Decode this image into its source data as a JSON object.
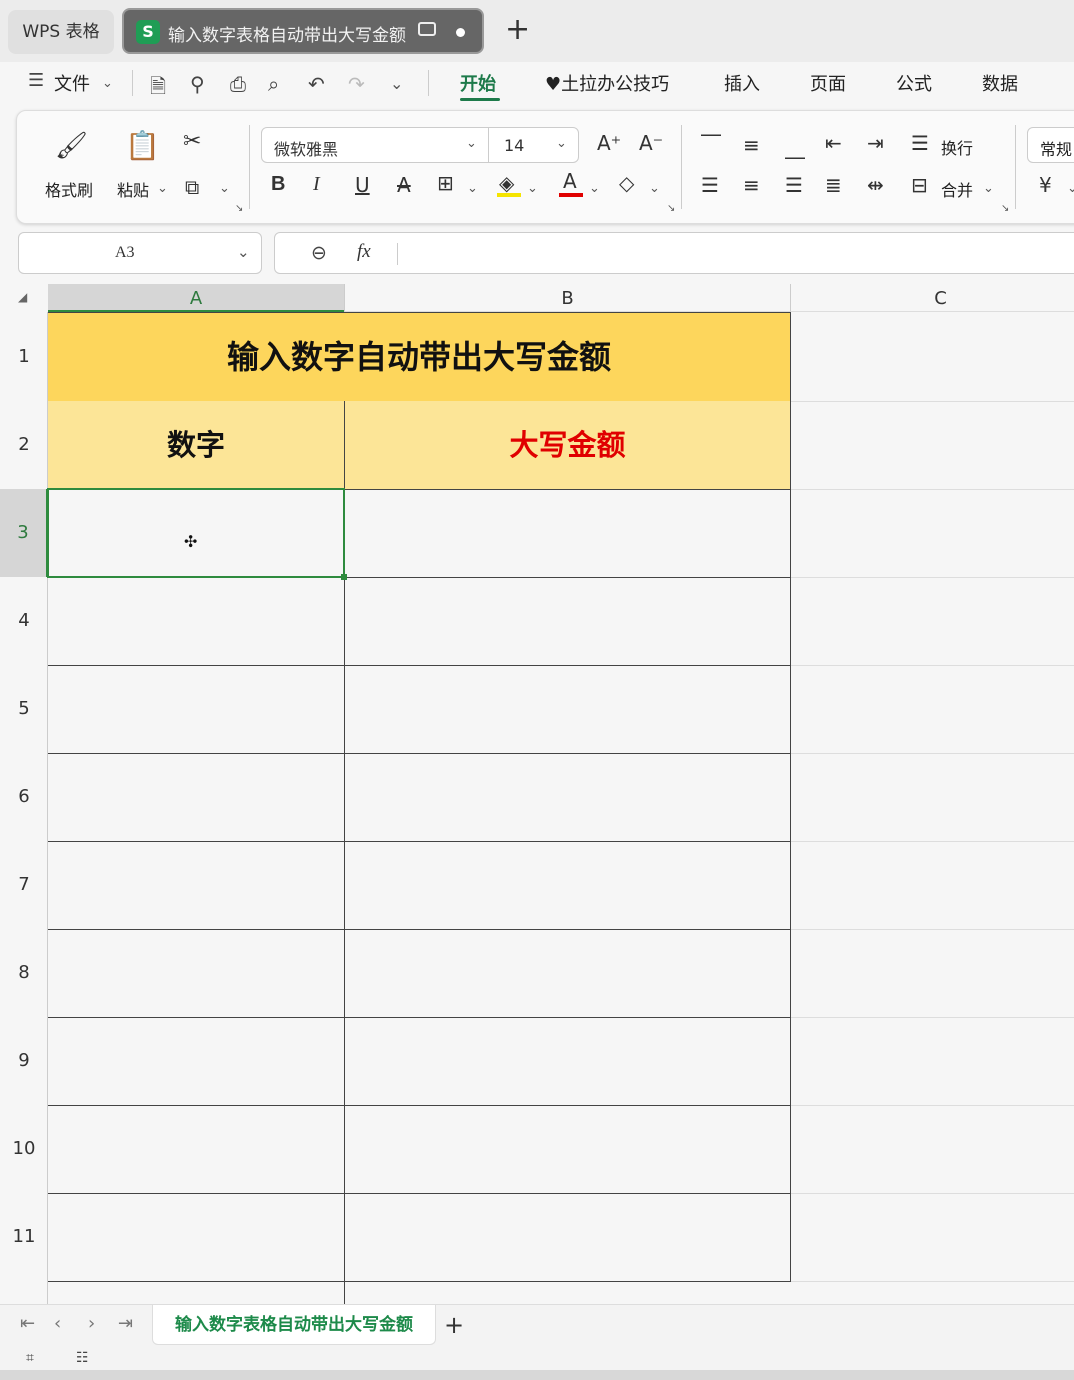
{
  "app": {
    "app_tab_label": "WPS 表格",
    "doc_tab_title": "输入数字表格自动带出大写金额",
    "doc_tab_icon": "S",
    "new_tab_icon": "+"
  },
  "menu": {
    "file_label": "文件",
    "tabs": [
      "开始",
      "♥土拉办公技巧",
      "插入",
      "页面",
      "公式",
      "数据"
    ],
    "active_tab": "开始"
  },
  "ribbon": {
    "format_painter_label": "格式刷",
    "paste_label": "粘贴",
    "font_name": "微软雅黑",
    "font_size": "14",
    "wrap_label": "换行",
    "merge_label": "合并",
    "number_format": "常规",
    "bold_glyph": "B",
    "italic_glyph": "I",
    "underline_glyph": "U",
    "font_color_glyph": "A",
    "currency_glyph": "¥",
    "colors": {
      "font_color": "#e00000",
      "fill_color": "#f5e400",
      "accent": "#1d7a4a"
    }
  },
  "formula_bar": {
    "cell_ref": "A3",
    "fx_label": "fx",
    "content": ""
  },
  "sheet": {
    "columns": [
      "A",
      "B",
      "C"
    ],
    "rows": [
      "1",
      "2",
      "3",
      "4",
      "5",
      "6",
      "7",
      "8",
      "9",
      "10",
      "11"
    ],
    "title": "输入数字自动带出大写金额",
    "header_a": "数字",
    "header_b": "大写金额",
    "selected_cell": "A3",
    "colors": {
      "title_fill": "#fdd65c",
      "header_fill": "#fce597",
      "header_b_text": "#e00000",
      "selection": "#2e8b3e"
    }
  },
  "sheet_tabs": {
    "active_sheet": "输入数字表格自动带出大写金额",
    "add_icon": "+"
  }
}
